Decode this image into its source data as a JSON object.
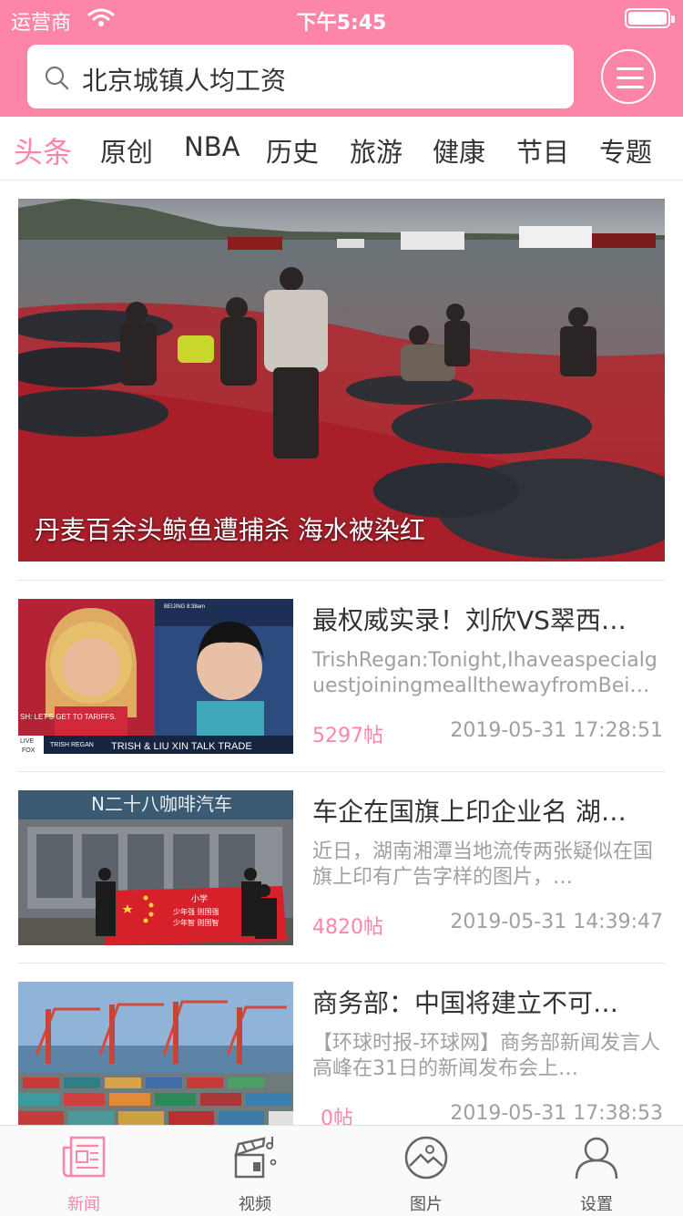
{
  "status_bar": {
    "carrier": "运营商",
    "time": "下午5:45"
  },
  "search": {
    "query": "北京城镇人均工资"
  },
  "tabs": [
    "头条",
    "原创",
    "NBA",
    "历史",
    "旅游",
    "健康",
    "节目",
    "专题"
  ],
  "active_tab": "头条",
  "hero": {
    "caption": "丹麦百余头鲸鱼遭捕杀 海水被染红"
  },
  "articles": [
    {
      "title": "最权威实录！刘欣VS翠西…",
      "summary": "TrishRegan:Tonight,Ihaveaspecialguestjoiningmeallthewayfrom​Bei…",
      "posts": "5297帖",
      "date": "2019-05-31 17:28:51",
      "thumb_texts": {
        "top_label": "BEIJING 8:38am",
        "banner": "SH: LET'S GET TO TARIFFS.",
        "name": "TRISH REGAN",
        "caption": "TRISH & LIU XIN TALK TRADE",
        "live": "LIVE",
        "network": "FOX"
      }
    },
    {
      "title": "车企在国旗上印企业名 湖…",
      "summary": "近日，湖南湘潭当地流传两张疑似在国旗上印有广告字样的图片，…",
      "posts": "4820帖",
      "date": "2019-05-31 14:39:47",
      "thumb_texts": {
        "sign": "N二十八咖啡汽车",
        "flag_line_1": "小学",
        "flag_line_2": "少年强  则国强",
        "flag_line_3": "少年智  则国智"
      }
    },
    {
      "title": "商务部：中国将建立不可…",
      "summary": "【环球时报-环球网】商务部新闻发言人高峰在31日的新闻发布会上…",
      "posts": "0帖",
      "date": "2019-05-31 17:38:53"
    }
  ],
  "bottom_tabs": [
    {
      "label": "新闻",
      "icon": "newspaper-icon"
    },
    {
      "label": "视频",
      "icon": "video-icon"
    },
    {
      "label": "图片",
      "icon": "image-icon"
    },
    {
      "label": "设置",
      "icon": "person-icon"
    }
  ],
  "colors": {
    "accent": "#fd86a8",
    "divider": "#e5e5e5",
    "muted_text": "#a0a0a0"
  }
}
